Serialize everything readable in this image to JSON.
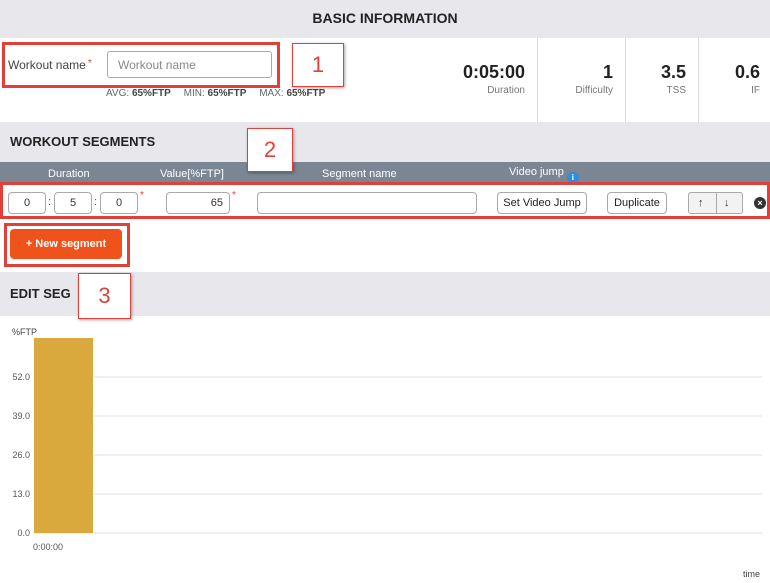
{
  "basic": {
    "title": "BASIC INFORMATION",
    "workout_name_label": "Workout name",
    "required_mark": "*",
    "workout_name_placeholder": "Workout name",
    "workout_name_value": "",
    "avg_label": "AVG:",
    "avg_value": "65%FTP",
    "min_label": "MIN:",
    "min_value": "65%FTP",
    "max_label": "MAX:",
    "max_value": "65%FTP",
    "metrics": [
      {
        "value": "0:05:00",
        "label": "Duration"
      },
      {
        "value": "1",
        "label": "Difficulty"
      },
      {
        "value": "3.5",
        "label": "TSS"
      },
      {
        "value": "0.6",
        "label": "IF"
      }
    ]
  },
  "callouts": [
    "1",
    "2",
    "3"
  ],
  "segments": {
    "title": "WORKOUT SEGMENTS",
    "columns": [
      "Duration",
      "Value[%FTP]",
      "Segment name",
      "Video jump"
    ],
    "info_icon": "i",
    "row": {
      "hours": "0",
      "minutes": "5",
      "seconds": "0",
      "value": "65",
      "segment_name": "",
      "set_video_jump": "Set Video Jump",
      "duplicate": "Duplicate",
      "up_arrow": "↑",
      "down_arrow": "↓",
      "remove_icon": "×"
    },
    "new_segment_label": "+ New segment"
  },
  "edit": {
    "title": "EDIT SEG"
  },
  "chart_data": {
    "type": "bar",
    "ylabel": "%FTP",
    "xlabel": "time",
    "y_ticks": [
      "0.0",
      "13.0",
      "26.0",
      "39.0",
      "52.0"
    ],
    "x_ticks": [
      "0:00:00"
    ],
    "ylim": [
      0,
      65
    ],
    "grid": true,
    "series": [
      {
        "values": [
          65
        ],
        "color": "#d9a93e"
      }
    ],
    "segments": [
      {
        "start": "0:00:00",
        "end": "0:05:00",
        "value": 65
      }
    ]
  }
}
